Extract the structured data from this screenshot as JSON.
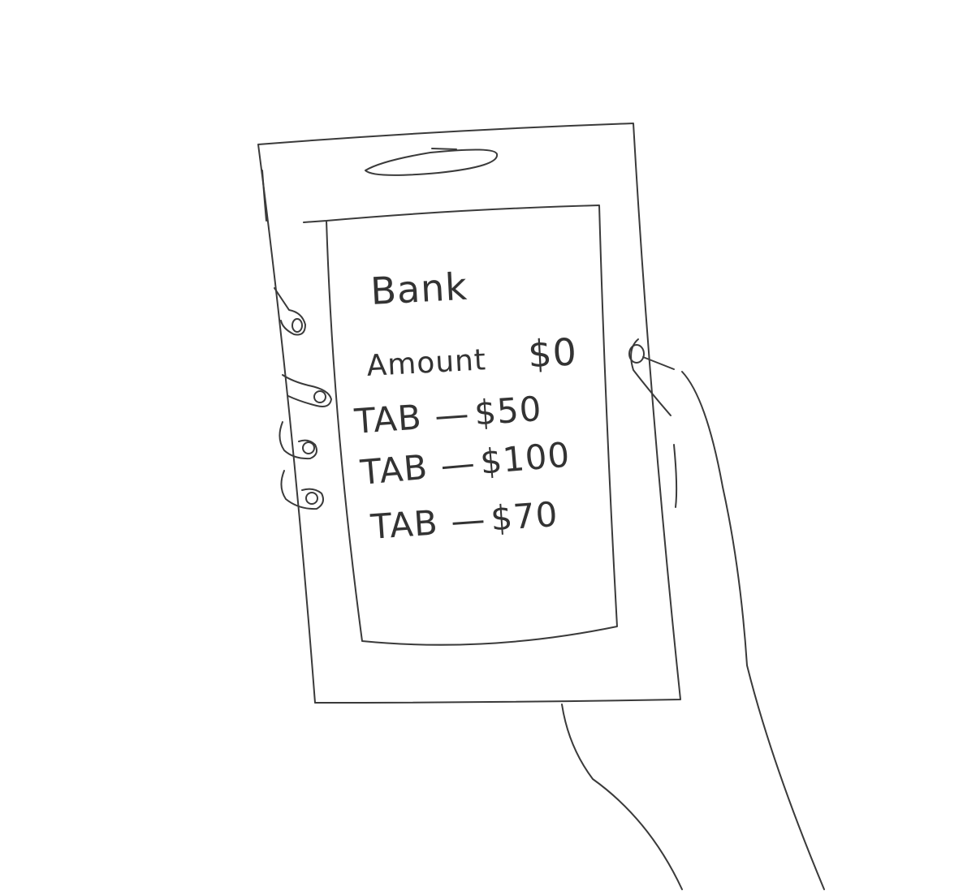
{
  "screen": {
    "title": "Bank",
    "amount": {
      "label": "Amount",
      "value": "$0"
    },
    "tabs": [
      {
        "label": "TAB",
        "separator": "—",
        "amount": "$50"
      },
      {
        "label": "TAB",
        "separator": "—",
        "amount": "$100"
      },
      {
        "label": "TAB",
        "separator": "—",
        "amount": "$70"
      }
    ]
  },
  "icons": {
    "earpiece": "speaker-slot-icon",
    "hand": "hand-drawing"
  },
  "colors": {
    "stroke": "#3a3a3a",
    "background": "#ffffff"
  }
}
